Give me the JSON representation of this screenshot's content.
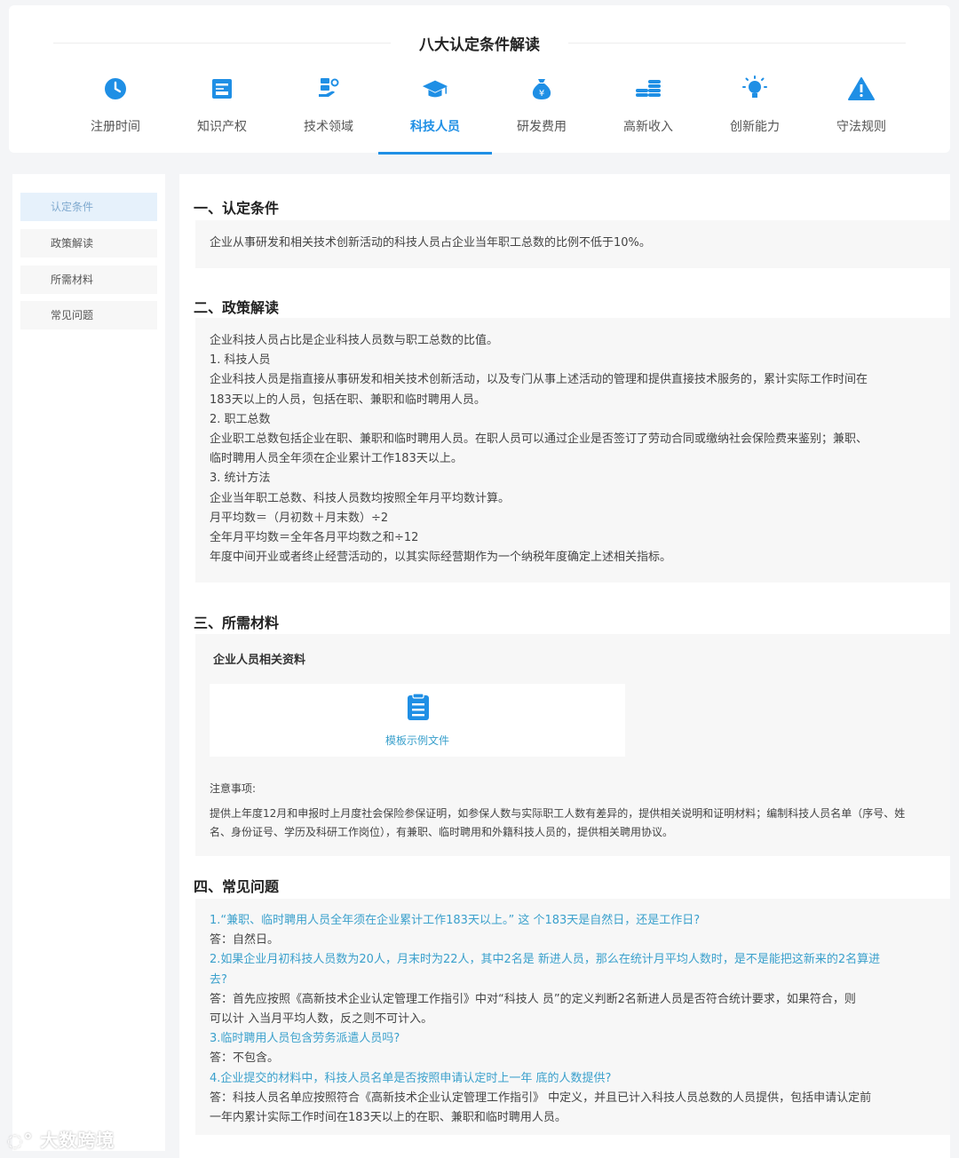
{
  "header": {
    "title": "八大认定条件解读"
  },
  "tabs": [
    {
      "label": "注册时间",
      "icon": "clock-icon"
    },
    {
      "label": "知识产权",
      "icon": "certificate-icon"
    },
    {
      "label": "技术领域",
      "icon": "tech-field-icon"
    },
    {
      "label": "科技人员",
      "icon": "graduation-cap-icon"
    },
    {
      "label": "研发费用",
      "icon": "money-bag-icon"
    },
    {
      "label": "高新收入",
      "icon": "coin-stack-icon"
    },
    {
      "label": "创新能力",
      "icon": "lightbulb-icon"
    },
    {
      "label": "守法规则",
      "icon": "warning-icon"
    }
  ],
  "colors": {
    "accent": "#1f8fe5",
    "question": "#3aa0cc",
    "sidebar_active": "#e6f1fb"
  },
  "sidebar": {
    "items": [
      {
        "label": "认定条件"
      },
      {
        "label": "政策解读"
      },
      {
        "label": "所需材料"
      },
      {
        "label": "常见问题"
      }
    ]
  },
  "sections": {
    "s1": {
      "title": "一、认定条件",
      "text": "企业从事研发和相关技术创新活动的科技人员占企业当年职工总数的比例不低于10%。"
    },
    "s2": {
      "title": "二、政策解读",
      "lines": [
        "企业科技人员占比是企业科技人员数与职工总数的比值。",
        "1. 科技人员",
        "企业科技人员是指直接从事研发和相关技术创新活动，以及专门从事上述活动的管理和提供直接技术服务的，累计实际工作时间在",
        "183天以上的人员，包括在职、兼职和临时聘用人员。",
        "2. 职工总数",
        "企业职工总数包括企业在职、兼职和临时聘用人员。在职人员可以通过企业是否签订了劳动合同或缴纳社会保险费来鉴别；兼职、",
        "临时聘用人员全年须在企业累计工作183天以上。",
        "3. 统计方法",
        "企业当年职工总数、科技人员数均按照全年月平均数计算。",
        "月平均数＝（月初数＋月末数）÷2",
        "全年月平均数＝全年各月平均数之和÷12",
        "年度中间开业或者终止经营活动的，以其实际经营期作为一个纳税年度确定上述相关指标。"
      ]
    },
    "s3": {
      "title": "三、所需材料",
      "subtitle": "企业人员相关资料",
      "template_label": "模板示例文件",
      "note_label": "注意事项:",
      "note_lines": [
        "提供上年度12月和申报时上月度社会保险参保证明，如参保人数与实际职工人数有差异的，提供相关说明和证明材料；编制科技人员名单（序号、姓",
        "名、身份证号、学历及科研工作岗位），有兼职、临时聘用和外籍科技人员的，提供相关聘用协议。"
      ]
    },
    "s4": {
      "title": "四、常见问题",
      "lines": [
        {
          "text": "1.“兼职、临时聘用人员全年须在企业累计工作183天以上。” 这 个183天是自然日，还是工作日?",
          "q": true
        },
        {
          "text": "答：自然日。",
          "q": false
        },
        {
          "text": "2.如果企业月初科技人员数为20人，月末时为22人，其中2名是 新进人员，那么在统计月平均人数时，是不是能把这新来的2名算进",
          "q": true
        },
        {
          "text": "去?",
          "q": true
        },
        {
          "text": "答：首先应按照《高新技术企业认定管理工作指引》中对“科技人 员”的定义判断2名新进人员是否符合统计要求，如果符合，则",
          "q": false
        },
        {
          "text": "可以计 入当月平均人数，反之则不可计入。",
          "q": false
        },
        {
          "text": "3.临时聘用人员包含劳务派遣人员吗?",
          "q": true
        },
        {
          "text": "答：不包含。",
          "q": false
        },
        {
          "text": "4.企业提交的材料中，科技人员名单是否按照申请认定时上一年 底的人数提供?",
          "q": true
        },
        {
          "text": "答：科技人员名单应按照符合《高新技术企业认定管理工作指引》 中定义，并且已计入科技人员总数的人员提供，包括申请认定前",
          "q": false
        },
        {
          "text": "一年内累计实际工作时间在183天以上的在职、兼职和临时聘用人员。",
          "q": false
        }
      ]
    }
  },
  "watermark": "大数跨境"
}
